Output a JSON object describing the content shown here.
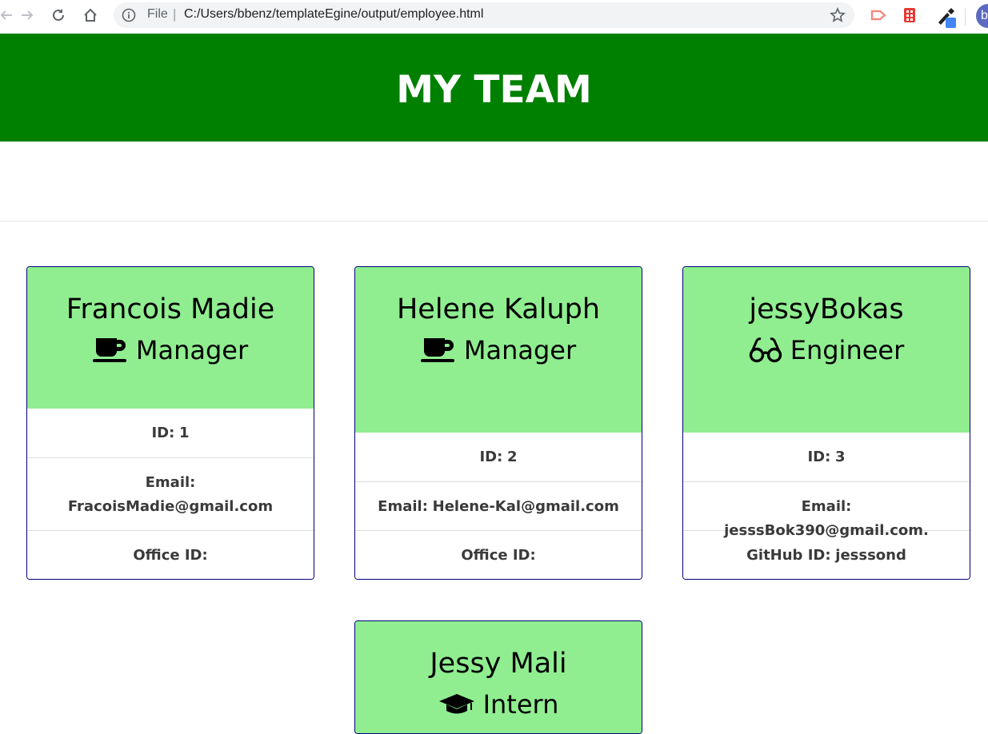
{
  "browser": {
    "scheme_label": "File",
    "separator": "|",
    "url": "C:/Users/bbenz/templateEgine/output/employee.html",
    "profile_initial": "b"
  },
  "page": {
    "title": "MY TEAM",
    "header_color": "#008000",
    "card_header_color": "#90ee90"
  },
  "cards": [
    {
      "name": "Francois Madie",
      "role": "Manager",
      "role_icon": "mug-icon",
      "id_label": "ID:",
      "id_value": "1",
      "email_label": "Email:",
      "email_value": "FracoisMadie@gmail.com",
      "extra_label": "Office ID:",
      "extra_value": ""
    },
    {
      "name": "Helene Kaluph",
      "role": "Manager",
      "role_icon": "mug-icon",
      "id_label": "ID:",
      "id_value": "2",
      "email_label": "Email:",
      "email_value": "Helene-Kal@gmail.com",
      "extra_label": "Office ID:",
      "extra_value": ""
    },
    {
      "name": "jessyBokas",
      "role": "Engineer",
      "role_icon": "glasses-icon",
      "id_label": "ID:",
      "id_value": "3",
      "email_label": "Email:",
      "email_value": "jesssBok390@gmail.com.",
      "extra_label": "GitHub ID:",
      "extra_value": "jesssond"
    },
    {
      "name": "Jessy Mali",
      "role": "Intern",
      "role_icon": "graduation-cap-icon"
    }
  ]
}
